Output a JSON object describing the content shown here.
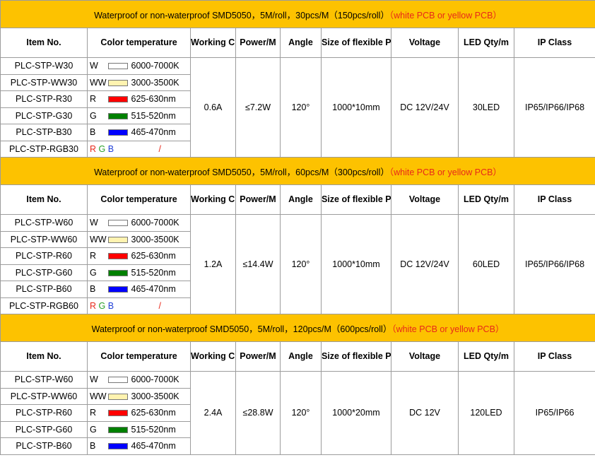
{
  "headers": {
    "item": "Item No.",
    "color": "Color temperature",
    "current": "Working Current",
    "power": "Power/M",
    "angle": "Angle",
    "size": "Size of flexible PCB",
    "voltage": "Voltage",
    "qty": "LED Qty/m",
    "ip": "IP Class"
  },
  "colors": {
    "band": "#fdc200",
    "note": "#e8281a",
    "white_swatch": "#ffffff",
    "warm_swatch": "#fff3b0",
    "red_swatch": "#ff0000",
    "green_swatch": "#008000",
    "blue_swatch": "#0000ff"
  },
  "sections": [
    {
      "title": "Waterproof or non-waterproof  SMD5050，5M/roll，30pcs/M（150pcs/roll）",
      "note": "（white PCB or yellow PCB）",
      "current": "0.6A",
      "power": "≤7.2W",
      "angle": "120°",
      "size": "1000*10mm",
      "voltage": "DC 12V/24V",
      "qty": "30LED",
      "ip": "IP65/IP66/IP68",
      "rows": [
        {
          "item": "PLC-STP-W30",
          "code": "W",
          "range": "6000-7000K"
        },
        {
          "item": "PLC-STP-WW30",
          "code": "WW",
          "range": "3000-3500K"
        },
        {
          "item": "PLC-STP-R30",
          "code": "R",
          "range": "625-630nm"
        },
        {
          "item": "PLC-STP-G30",
          "code": "G",
          "range": "515-520nm"
        },
        {
          "item": "PLC-STP-B30",
          "code": "B",
          "range": "465-470nm"
        },
        {
          "item": "PLC-STP-RGB30",
          "code": "RGB",
          "range": "/"
        }
      ]
    },
    {
      "title": "Waterproof or non-waterproof  SMD5050，5M/roll，60pcs/M（300pcs/roll）",
      "note": "（white PCB or yellow PCB）",
      "current": "1.2A",
      "power": "≤14.4W",
      "angle": "120°",
      "size": "1000*10mm",
      "voltage": "DC 12V/24V",
      "qty": "60LED",
      "ip": "IP65/IP66/IP68",
      "rows": [
        {
          "item": "PLC-STP-W60",
          "code": "W",
          "range": "6000-7000K"
        },
        {
          "item": "PLC-STP-WW60",
          "code": "WW",
          "range": "3000-3500K"
        },
        {
          "item": "PLC-STP-R60",
          "code": "R",
          "range": "625-630nm"
        },
        {
          "item": "PLC-STP-G60",
          "code": "G",
          "range": "515-520nm"
        },
        {
          "item": "PLC-STP-B60",
          "code": "B",
          "range": "465-470nm"
        },
        {
          "item": "PLC-STP-RGB60",
          "code": "RGB",
          "range": "/"
        }
      ]
    },
    {
      "title": "Waterproof or non-waterproof  SMD5050，5M/roll，120pcs/M（600pcs/roll）",
      "note": "（white PCB or yellow PCB）",
      "current": "2.4A",
      "power": "≤28.8W",
      "angle": "120°",
      "size": "1000*20mm",
      "voltage": "DC 12V",
      "qty": "120LED",
      "ip": "IP65/IP66",
      "rows": [
        {
          "item": "PLC-STP-W60",
          "code": "W",
          "range": "6000-7000K"
        },
        {
          "item": "PLC-STP-WW60",
          "code": "WW",
          "range": "3000-3500K"
        },
        {
          "item": "PLC-STP-R60",
          "code": "R",
          "range": "625-630nm"
        },
        {
          "item": "PLC-STP-G60",
          "code": "G",
          "range": "515-520nm"
        },
        {
          "item": "PLC-STP-B60",
          "code": "B",
          "range": "465-470nm"
        }
      ]
    }
  ]
}
